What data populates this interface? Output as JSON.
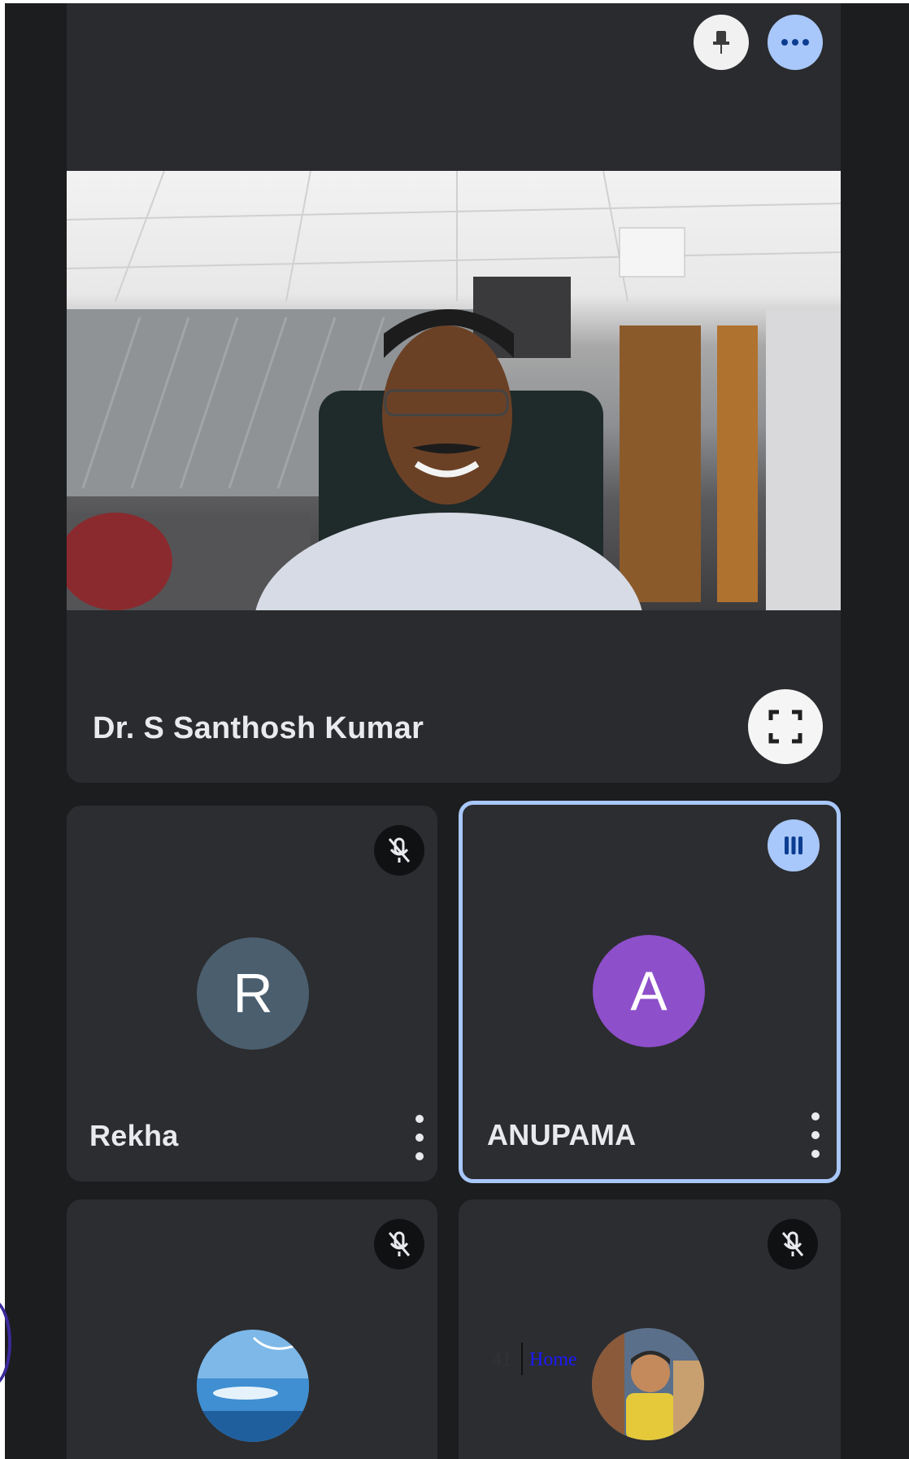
{
  "meeting": {
    "main_participant": {
      "name": "Dr. S Santhosh Kumar"
    },
    "icons": {
      "pin": "pin-icon",
      "more": "more-options-icon",
      "fullscreen": "fullscreen-icon"
    },
    "participants": [
      {
        "name": "Rekha",
        "initial": "R",
        "avatar_color": "#4a5e6e",
        "muted": true,
        "speaking": false
      },
      {
        "name": "ANUPAMA",
        "initial": "A",
        "avatar_color": "#8e4fcb",
        "muted": false,
        "speaking": true
      },
      {
        "name": "",
        "initial": "",
        "avatar": "landscape-photo",
        "muted": true
      },
      {
        "name": "",
        "initial": "",
        "avatar": "person-photo",
        "muted": true
      }
    ]
  },
  "colors": {
    "background": "#1c1d1f",
    "tile": "#2c2d30",
    "speaking_border": "#a8c7fa",
    "accent": "#a8c7fa"
  },
  "footer": {
    "page_number": "41",
    "home_link": "Home"
  }
}
